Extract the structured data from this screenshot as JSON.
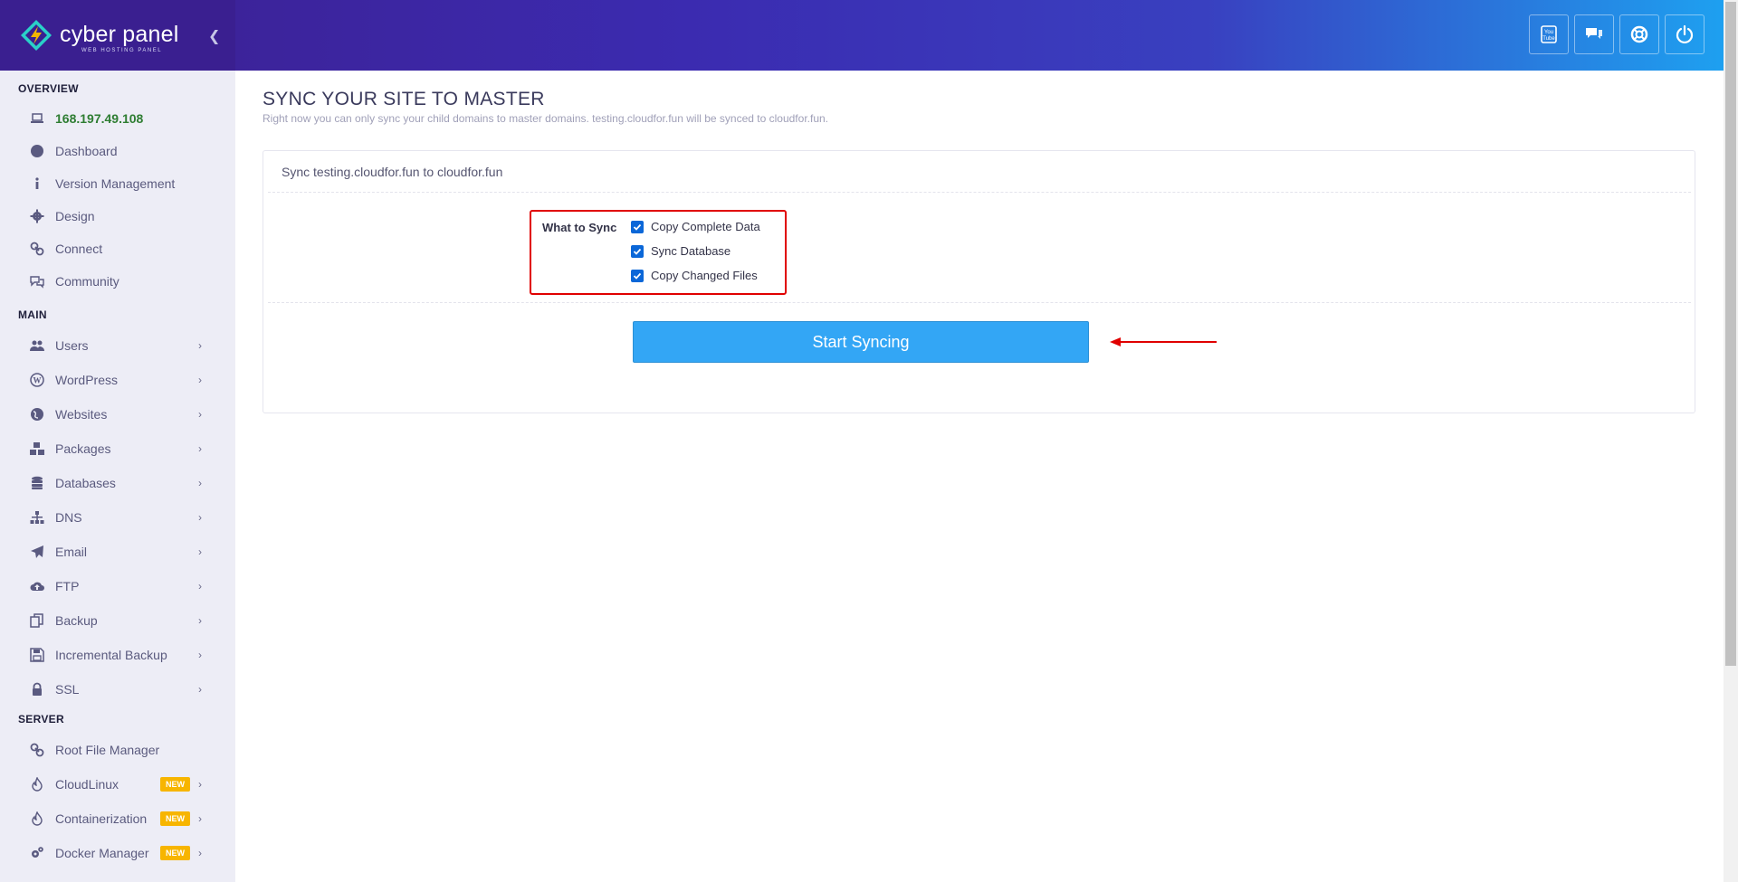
{
  "header": {
    "logo_text": "cyber panel",
    "logo_sub": "WEB HOSTING PANEL",
    "collapse_icon": "chevron-left-icon",
    "buttons": [
      {
        "name": "youtube-button",
        "icon": "youtube-icon"
      },
      {
        "name": "chat-button",
        "icon": "chat-icon"
      },
      {
        "name": "support-button",
        "icon": "lifebuoy-icon"
      },
      {
        "name": "logout-button",
        "icon": "power-icon"
      }
    ]
  },
  "sidebar": {
    "overview_title": "OVERVIEW",
    "main_title": "MAIN",
    "server_title": "SERVER",
    "overview_items": [
      {
        "label": "168.197.49.108",
        "icon": "laptop-icon"
      },
      {
        "label": "Dashboard",
        "icon": "palette-icon"
      },
      {
        "label": "Version Management",
        "icon": "info-icon"
      },
      {
        "label": "Design",
        "icon": "gear-icon"
      },
      {
        "label": "Connect",
        "icon": "link-icon"
      },
      {
        "label": "Community",
        "icon": "comments-icon"
      }
    ],
    "main_items": [
      {
        "label": "Users",
        "icon": "users-icon"
      },
      {
        "label": "WordPress",
        "icon": "wordpress-icon"
      },
      {
        "label": "Websites",
        "icon": "globe-icon"
      },
      {
        "label": "Packages",
        "icon": "cubes-icon"
      },
      {
        "label": "Databases",
        "icon": "database-icon"
      },
      {
        "label": "DNS",
        "icon": "sitemap-icon"
      },
      {
        "label": "Email",
        "icon": "paper-plane-icon"
      },
      {
        "label": "FTP",
        "icon": "cloud-upload-icon"
      },
      {
        "label": "Backup",
        "icon": "copy-icon"
      },
      {
        "label": "Incremental Backup",
        "icon": "save-icon"
      },
      {
        "label": "SSL",
        "icon": "lock-icon"
      }
    ],
    "server_items": [
      {
        "label": "Root File Manager",
        "icon": "link-icon"
      },
      {
        "label": "CloudLinux",
        "icon": "fire-icon",
        "badge": "NEW"
      },
      {
        "label": "Containerization",
        "icon": "fire-icon",
        "badge": "NEW"
      },
      {
        "label": "Docker Manager",
        "icon": "cogs-icon",
        "badge": "NEW"
      }
    ],
    "chevron": "›"
  },
  "main": {
    "title": "SYNC YOUR SITE TO MASTER",
    "subtitle": "Right now you can only sync your child domains to master domains. testing.cloudfor.fun will be synced to cloudfor.fun.",
    "card_heading": "Sync testing.cloudfor.fun to cloudfor.fun",
    "what_to_sync_label": "What to Sync",
    "options": [
      {
        "label": "Copy Complete Data",
        "checked": true
      },
      {
        "label": "Sync Database",
        "checked": true
      },
      {
        "label": "Copy Changed Files",
        "checked": true
      }
    ],
    "start_button": "Start Syncing"
  },
  "colors": {
    "accent": "#33a6f5",
    "highlight_box": "#e00000",
    "ip_green": "#2e7d32",
    "badge": "#f7b500"
  }
}
